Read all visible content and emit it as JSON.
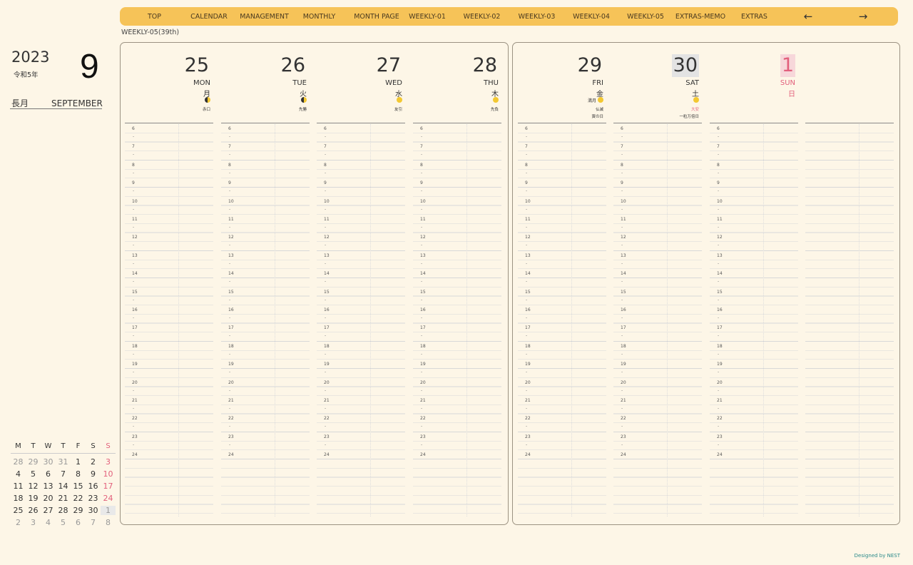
{
  "nav": {
    "items": [
      "TOP",
      "CALENDAR",
      "MANAGEMENT",
      "MONTHLY",
      "MONTH PAGE",
      "WEEKLY-01",
      "WEEKLY-02",
      "WEEKLY-03",
      "WEEKLY-04",
      "WEEKLY-05",
      "EXTRAS-MEMO",
      "EXTRAS"
    ],
    "prev": "←",
    "next": "→"
  },
  "week_label": "WEEKLY-05(39th)",
  "sidebar": {
    "year": "2023",
    "era": "令和5年",
    "month_number": "9",
    "month_jp": "長月",
    "month_en": "SEPTEMBER"
  },
  "mini_calendar": {
    "headers": [
      "M",
      "T",
      "W",
      "T",
      "F",
      "S",
      "S"
    ],
    "weeks": [
      [
        "28",
        "29",
        "30",
        "31",
        "1",
        "2",
        "3"
      ],
      [
        "4",
        "5",
        "6",
        "7",
        "8",
        "9",
        "10"
      ],
      [
        "11",
        "12",
        "13",
        "14",
        "15",
        "16",
        "17"
      ],
      [
        "18",
        "19",
        "20",
        "21",
        "22",
        "23",
        "24"
      ],
      [
        "25",
        "26",
        "27",
        "28",
        "29",
        "30",
        "1"
      ],
      [
        "2",
        "3",
        "4",
        "5",
        "6",
        "7",
        "8"
      ]
    ]
  },
  "days": [
    {
      "num": "25",
      "en": "MON",
      "jp": "月",
      "moon": "half",
      "moon_label": "",
      "note1": "赤口",
      "note2": "",
      "kind": "weekday"
    },
    {
      "num": "26",
      "en": "TUE",
      "jp": "火",
      "moon": "half",
      "moon_label": "",
      "note1": "先勝",
      "note2": "",
      "kind": "weekday"
    },
    {
      "num": "27",
      "en": "WED",
      "jp": "水",
      "moon": "full",
      "moon_label": "",
      "note1": "友引",
      "note2": "",
      "kind": "weekday"
    },
    {
      "num": "28",
      "en": "THU",
      "jp": "木",
      "moon": "full",
      "moon_label": "",
      "note1": "先負",
      "note2": "",
      "kind": "weekday"
    },
    {
      "num": "29",
      "en": "FRI",
      "jp": "金",
      "moon": "full",
      "moon_label": "満月",
      "note1": "仏滅",
      "note2": "寅の日",
      "kind": "weekday"
    },
    {
      "num": "30",
      "en": "SAT",
      "jp": "土",
      "moon": "full",
      "moon_label": "",
      "note1": "大安",
      "note2": "一粒万倍日",
      "kind": "sat"
    },
    {
      "num": "1",
      "en": "SUN",
      "jp": "日",
      "moon": "",
      "moon_label": "",
      "note1": "",
      "note2": "",
      "kind": "sun"
    }
  ],
  "hours": [
    "6",
    "7",
    "8",
    "9",
    "10",
    "11",
    "12",
    "13",
    "14",
    "15",
    "16",
    "17",
    "18",
    "19",
    "20",
    "21",
    "22",
    "23",
    "24"
  ],
  "half_mark": "-",
  "credit": "Designed by NEST",
  "colors": {
    "nav": "#f6c358",
    "background": "#fdf6e7",
    "sunday": "#e2607c",
    "saturday_bg": "#e3e3e3",
    "sunday_bg": "#f7d7da",
    "moon": "#f3c832"
  }
}
